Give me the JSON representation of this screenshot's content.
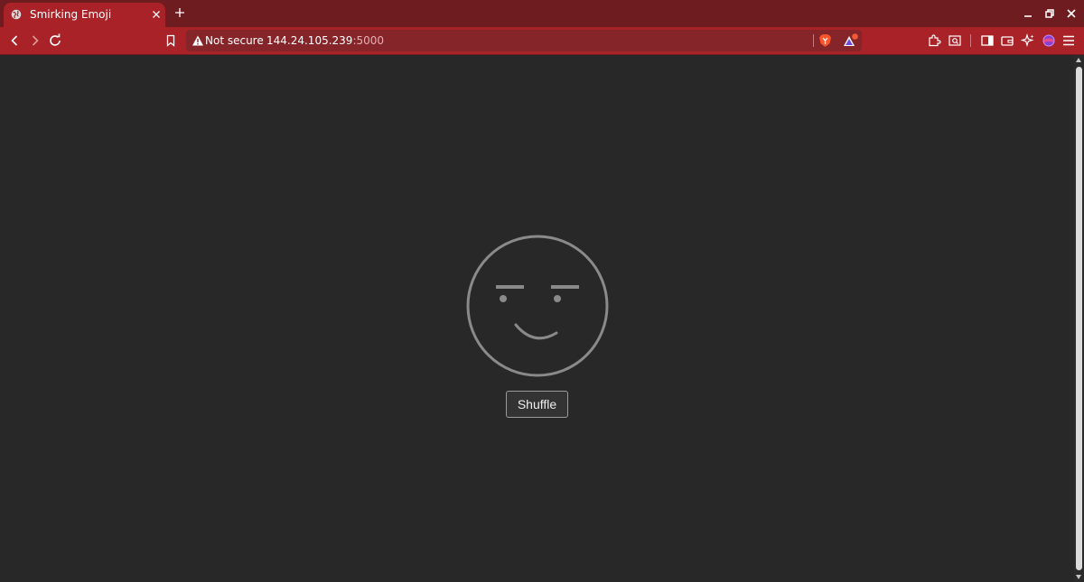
{
  "browser": {
    "tab": {
      "title": "Smirking Emoji",
      "favicon": "globe-icon"
    },
    "address_bar": {
      "security_label": "Not secure",
      "host": "144.24.105.239",
      "port": ":5000"
    },
    "colors": {
      "tabstrip": "#6f1c20",
      "toolbar": "#a82227",
      "page_background": "#282828"
    }
  },
  "page": {
    "emoji": "smirking-face",
    "shuffle_label": "Shuffle"
  }
}
